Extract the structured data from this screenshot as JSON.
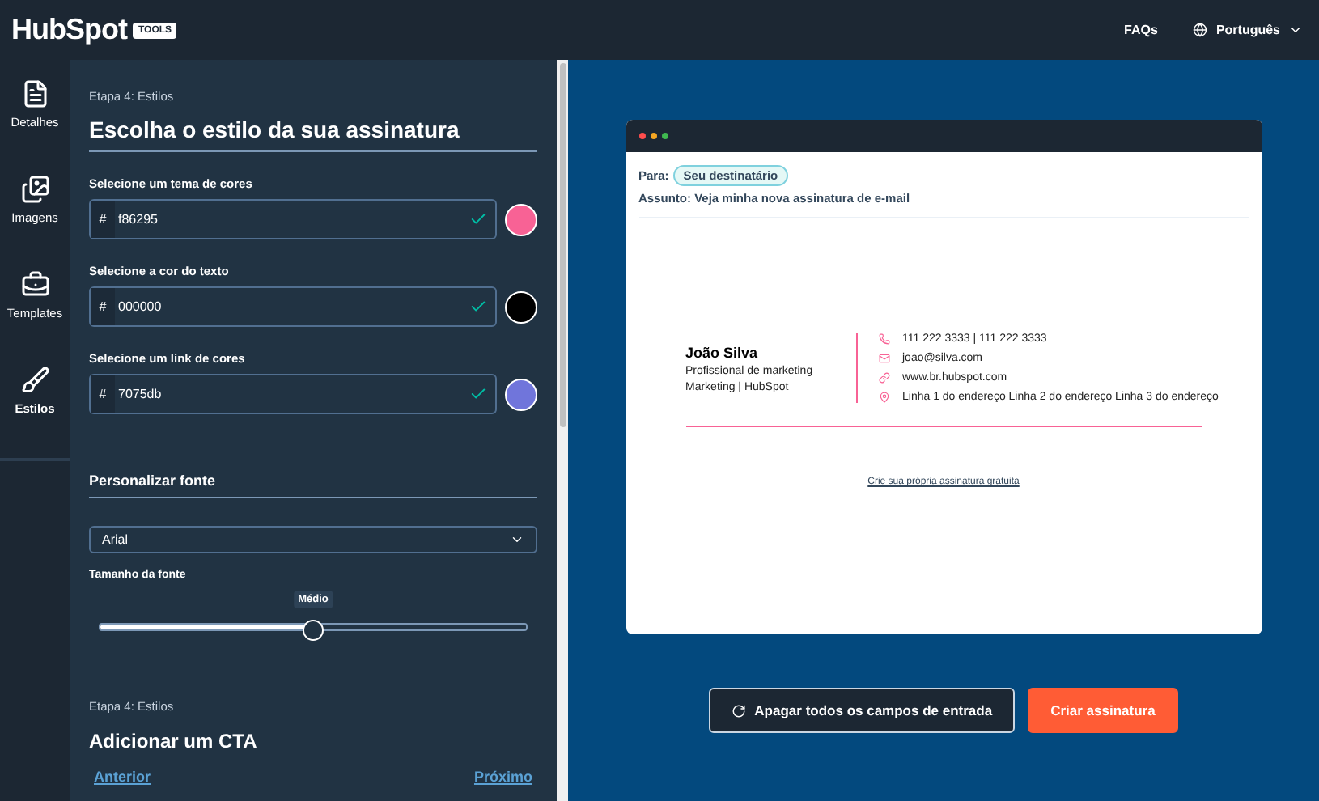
{
  "header": {
    "logo": "HubSpot",
    "badge": "TOOLS",
    "links": [
      "FAQs"
    ],
    "language": "Português"
  },
  "nav": [
    {
      "label": "Detalhes",
      "selected": false
    },
    {
      "label": "Imagens",
      "selected": false
    },
    {
      "label": "Templates",
      "selected": false
    },
    {
      "label": "Estilos",
      "selected": true
    }
  ],
  "panel": {
    "step": "Etapa 4: Estilos",
    "title": "Escolha o estilo da sua assinatura",
    "colors": [
      {
        "label": "Selecione um tema de cores",
        "prefix": "#",
        "value": "f86295",
        "color": "#f86295"
      },
      {
        "label": "Selecione a cor do texto",
        "prefix": "#",
        "value": "000000",
        "color": "#000000"
      },
      {
        "label": "Selecione um link de cores",
        "prefix": "#",
        "value": "7075db",
        "color": "#7075db"
      }
    ],
    "font_section": "Personalizar fonte",
    "font": "Arial",
    "size_label": "Tamanho da fonte",
    "size_tooltip": "Médio",
    "level": 0.5,
    "next_step": "Etapa 4: Estilos",
    "next_title": "Adicionar um CTA",
    "prev_link": "Anterior",
    "next_link": "Próximo"
  },
  "preview": {
    "to_label": "Para:",
    "recipient": "Seu destinatário",
    "subject": "Assunto: Veja minha nova assinatura de e-mail",
    "name": "João Silva",
    "role": "Profissional de marketing",
    "company": "Marketing | HubSpot",
    "contacts": [
      {
        "kind": "phone",
        "text": "111 222 3333 | 111 222 3333"
      },
      {
        "kind": "email",
        "text": "joao@silva.com"
      },
      {
        "kind": "link",
        "text": "www.br.hubspot.com"
      },
      {
        "kind": "address",
        "text": "Linha 1 do endereço Linha 2 do endereço Linha 3 do endereço"
      }
    ],
    "footer_link": "Crie sua própria assinatura gratuita"
  },
  "buttons": [
    {
      "kind": "secondary",
      "label": "Apagar todos os campos de entrada"
    },
    {
      "kind": "primary",
      "label": "Criar assinatura"
    }
  ]
}
